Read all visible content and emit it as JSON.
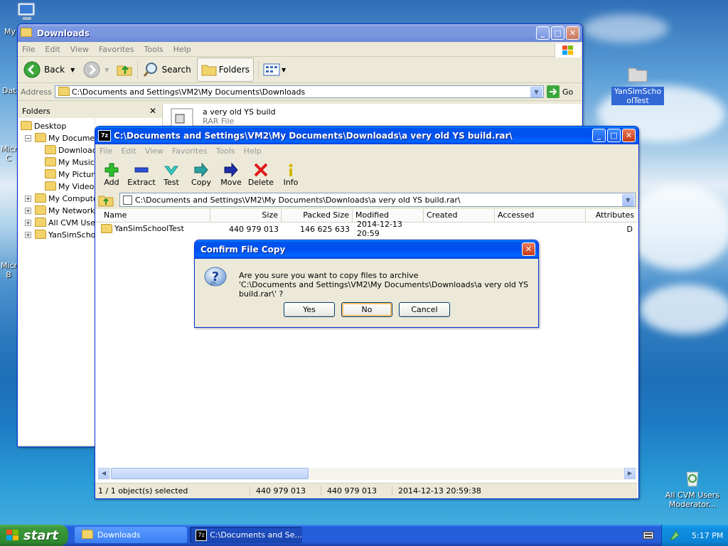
{
  "desktop": {
    "icons": [
      {
        "label": "YanSimSchoolTest"
      },
      {
        "label": "All CVM Users Moderator..."
      }
    ],
    "clipped_labels": [
      "My",
      "Dat",
      "Micro C",
      "Micro B"
    ]
  },
  "explorer": {
    "title": "Downloads",
    "menu": [
      "File",
      "Edit",
      "View",
      "Favorites",
      "Tools",
      "Help"
    ],
    "toolbar": {
      "back": "Back",
      "search": "Search",
      "folders": "Folders"
    },
    "address_label": "Address",
    "address": "C:\\Documents and Settings\\VM2\\My Documents\\Downloads",
    "go": "Go",
    "folders_pane_title": "Folders",
    "tree": [
      {
        "label": "Desktop",
        "level": 0
      },
      {
        "label": "My Document",
        "level": 1
      },
      {
        "label": "Download",
        "level": 2
      },
      {
        "label": "My Music",
        "level": 2
      },
      {
        "label": "My Pictur",
        "level": 2
      },
      {
        "label": "My Videos",
        "level": 2
      },
      {
        "label": "My Computer",
        "level": 1
      },
      {
        "label": "My Network P",
        "level": 1
      },
      {
        "label": "All CVM Users",
        "level": 1
      },
      {
        "label": "YanSimSchoo",
        "level": 1
      }
    ],
    "file_item": {
      "name": "a very old YS build",
      "type": "RAR File"
    }
  },
  "sevenzip": {
    "title": "C:\\Documents and Settings\\VM2\\My Documents\\Downloads\\a very old YS build.rar\\",
    "menu": [
      "File",
      "Edit",
      "View",
      "Favorites",
      "Tools",
      "Help"
    ],
    "toolbar": [
      "Add",
      "Extract",
      "Test",
      "Copy",
      "Move",
      "Delete",
      "Info"
    ],
    "path": "C:\\Documents and Settings\\VM2\\My Documents\\Downloads\\a very old YS build.rar\\",
    "columns": [
      "Name",
      "Size",
      "Packed Size",
      "Modified",
      "Created",
      "Accessed",
      "Attributes"
    ],
    "rows": [
      {
        "name": "YanSimSchoolTest",
        "size": "440 979 013",
        "packed": "146 625 633",
        "modified": "2014-12-13 20:59",
        "created": "",
        "accessed": "",
        "attributes": "D"
      }
    ],
    "status": [
      "1 / 1 object(s) selected",
      "440 979 013",
      "440 979 013",
      "2014-12-13 20:59:38"
    ]
  },
  "dialog": {
    "title": "Confirm File Copy",
    "message_line1": "Are you sure you want to copy files to archive",
    "message_line2": "'C:\\Documents and Settings\\VM2\\My Documents\\Downloads\\a very old YS build.rar\\' ?",
    "yes": "Yes",
    "no": "No",
    "cancel": "Cancel"
  },
  "taskbar": {
    "start": "start",
    "tasks": [
      "Downloads",
      "C:\\Documents and Se..."
    ],
    "clock": "5:17 PM"
  }
}
